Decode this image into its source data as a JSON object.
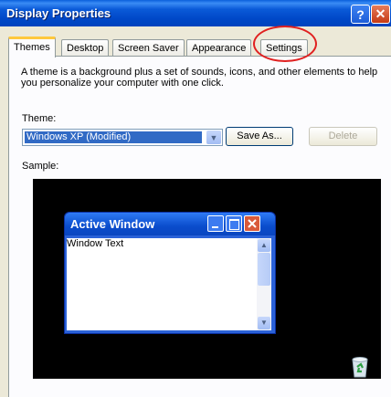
{
  "window": {
    "title": "Display Properties",
    "help_glyph": "?",
    "close_glyph": "✕"
  },
  "tabs": [
    {
      "label": "Themes",
      "active": true
    },
    {
      "label": "Desktop",
      "active": false
    },
    {
      "label": "Screen Saver",
      "active": false
    },
    {
      "label": "Appearance",
      "active": false
    },
    {
      "label": "Settings",
      "active": false
    }
  ],
  "themes_tab": {
    "description": "A theme is a background plus a set of sounds, icons, and other elements to help you personalize your computer with one click.",
    "theme_label": "Theme:",
    "theme_value": "Windows XP (Modified)",
    "save_as_label": "Save As...",
    "delete_label": "Delete",
    "sample_label": "Sample:"
  },
  "sample_preview": {
    "window_title": "Active Window",
    "window_text": "Window Text"
  },
  "colors": {
    "accent": "#0a5ad8",
    "highlight_circle": "#e02020",
    "tab_hot": "#ffc83c"
  }
}
